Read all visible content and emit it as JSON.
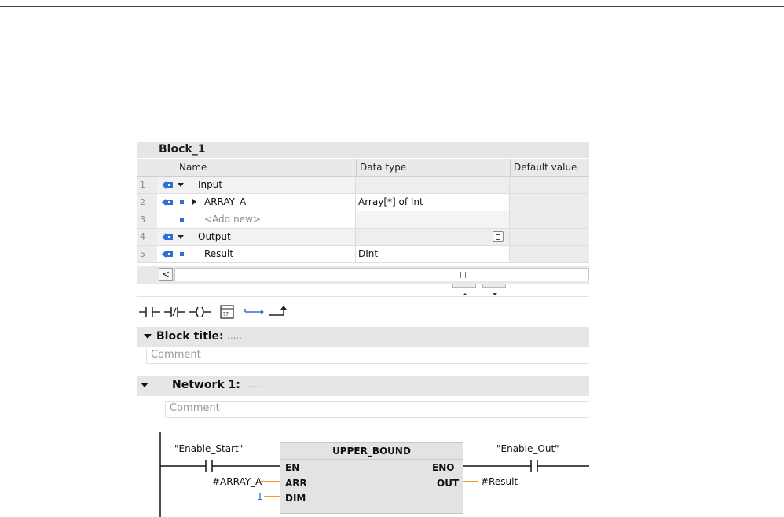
{
  "block": {
    "name": "Block_1"
  },
  "table": {
    "headers": {
      "name": "Name",
      "data_type": "Data type",
      "default_value": "Default value"
    },
    "rows": [
      {
        "num": "1",
        "name": "Input",
        "data_type": ""
      },
      {
        "num": "2",
        "name": "ARRAY_A",
        "data_type": "Array[*] of Int"
      },
      {
        "num": "3",
        "name": "<Add new>",
        "data_type": ""
      },
      {
        "num": "4",
        "name": "Output",
        "data_type": ""
      },
      {
        "num": "5",
        "name": "Result",
        "data_type": "DInt"
      }
    ],
    "scroll_left": "<"
  },
  "toolbar": {
    "icons": [
      "normally-open-contact-icon",
      "normally-closed-contact-icon",
      "coil-icon",
      "empty-box-icon",
      "open-branch-icon",
      "close-branch-icon"
    ]
  },
  "block_title": {
    "label": "Block title:",
    "dots": ".....",
    "comment": "Comment"
  },
  "network": {
    "label": "Network 1:",
    "dots": ".....",
    "comment": "Comment"
  },
  "ladder": {
    "contact_in_tag": "\"Enable_Start\"",
    "contact_out_tag": "\"Enable_Out\"",
    "box_title": "UPPER_BOUND",
    "pins": {
      "en": "EN",
      "arr": "ARR",
      "dim": "DIM",
      "eno": "ENO",
      "out": "OUT"
    },
    "arr_operand": "#ARRAY_A",
    "dim_operand": "1",
    "out_operand": "#Result"
  },
  "colors": {
    "accent": "#2f6fd6",
    "orange": "#f0a020",
    "section_bg": "#e6e6e6"
  }
}
